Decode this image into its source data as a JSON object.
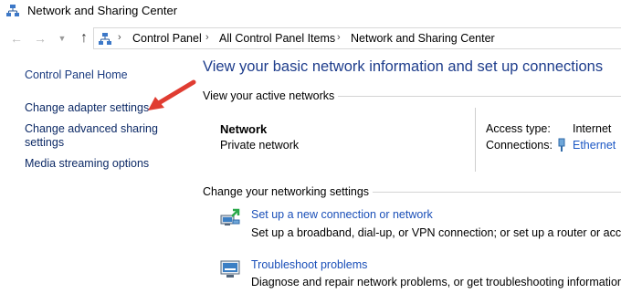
{
  "window": {
    "title": "Network and Sharing Center"
  },
  "nav": {
    "back_icon": "back-arrow-icon",
    "forward_icon": "forward-arrow-icon",
    "recent_icon": "chevron-down-icon",
    "up_icon": "up-arrow-icon"
  },
  "breadcrumb": {
    "items": [
      "Control Panel",
      "All Control Panel Items",
      "Network and Sharing Center"
    ],
    "separator": "›"
  },
  "left_pane": {
    "home": "Control Panel Home",
    "adapter": "Change adapter settings",
    "sharing_line1": "Change advanced sharing",
    "sharing_line2": "settings",
    "media": "Media streaming options"
  },
  "main": {
    "title": "View your basic network information and set up connections",
    "active_networks_header": "View your active networks",
    "network": {
      "name": "Network",
      "type": "Private network",
      "access_type_label": "Access type:",
      "access_type_value": "Internet",
      "connections_label": "Connections:",
      "connections_value": "Ethernet"
    },
    "change_settings_header": "Change your networking settings",
    "tasks": [
      {
        "link": "Set up a new connection or network",
        "desc": "Set up a broadband, dial-up, or VPN connection; or set up a router or access p"
      },
      {
        "link": "Troubleshoot problems",
        "desc": "Diagnose and repair network problems, or get troubleshooting information."
      }
    ]
  },
  "colors": {
    "link": "#1a4fb8",
    "title_blue": "#1e3d8c",
    "arrow_red": "#e03c31"
  }
}
